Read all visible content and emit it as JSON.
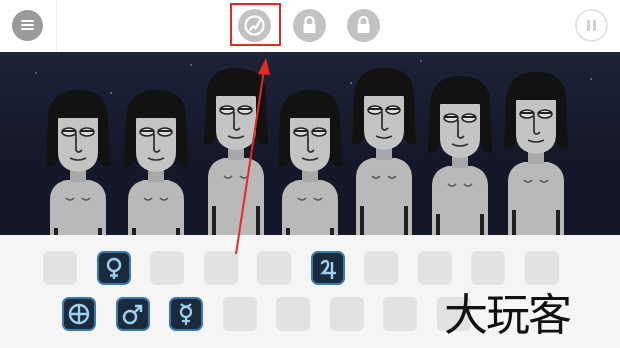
{
  "topbar": {
    "menu_icon": "hamburger-menu-icon",
    "mode_buttons": [
      {
        "icon": "play-mode-icon",
        "state": "selected"
      },
      {
        "icon": "lock-icon",
        "state": "locked"
      },
      {
        "icon": "lock-icon",
        "state": "locked"
      }
    ],
    "pause_icon": "pause-icon"
  },
  "stage": {
    "performer_count": 7
  },
  "sound_palette": {
    "rows": [
      [
        "empty",
        "venus-symbol-icon",
        "empty",
        "empty",
        "empty",
        "jupiter-symbol-icon",
        "empty",
        "empty",
        "empty",
        "empty"
      ],
      [
        "earth-symbol-icon",
        "mars-symbol-icon",
        "mercury-symbol-icon",
        "empty",
        "empty",
        "empty",
        "empty",
        "empty"
      ]
    ]
  },
  "annotation": {
    "highlight_color": "#e32b22",
    "arrow_color": "#e32b22"
  },
  "watermark": {
    "text": "大玩客"
  },
  "colors": {
    "stage_bg": "#151828",
    "icon_slot_bg": "#1b2a3c",
    "icon_slot_border": "#3b79ac",
    "icon_glyph": "#9fd0ee",
    "empty_slot": "#e2e2e2"
  }
}
